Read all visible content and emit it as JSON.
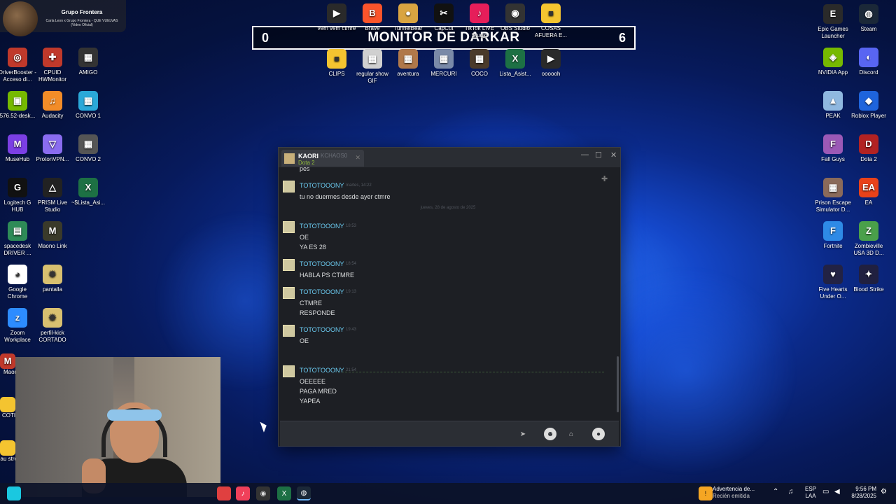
{
  "profile": {
    "name": "Grupo Frontera",
    "song": "Carla Leon x Grupo Frontera - QUE VUELVAS (Video Oficial)"
  },
  "banner": {
    "left_score": "0",
    "title": "MONITOR DE DARKAR",
    "right_score": "6"
  },
  "top_icons": [
    {
      "label": "vem vem ctmre",
      "color": "#2a2a2a",
      "glyph": "▶"
    },
    {
      "label": "Brave",
      "color": "#fb542b",
      "glyph": "B"
    },
    {
      "label": "TunnelBear",
      "color": "#d9a441",
      "glyph": "●"
    },
    {
      "label": "CapCut",
      "color": "#111111",
      "glyph": "✂"
    },
    {
      "label": "TikTok LIVE Studio",
      "color": "#e61e5a",
      "glyph": "♪"
    },
    {
      "label": "OBS Studio",
      "color": "#333333",
      "glyph": "◉"
    },
    {
      "label": "COSAS AFUERA E...",
      "color": "#f4c430",
      "glyph": "■"
    },
    {
      "label": "CLIPS",
      "color": "#f4c430",
      "glyph": "■"
    },
    {
      "label": "regular show GIF",
      "color": "#d0d0d0",
      "glyph": "▦"
    },
    {
      "label": "aventura",
      "color": "#b0784a",
      "glyph": "▦"
    },
    {
      "label": "MERCURI",
      "color": "#7a8aa8",
      "glyph": "▦"
    },
    {
      "label": "COCO",
      "color": "#4a3a2a",
      "glyph": "▦"
    },
    {
      "label": "Lista_Asist...",
      "color": "#1d7044",
      "glyph": "X"
    },
    {
      "label": "oooooh",
      "color": "#2a2a2a",
      "glyph": "▶"
    }
  ],
  "left_icons": [
    {
      "label": "DriverBooster - Acceso di...",
      "color": "#c0392b",
      "glyph": "◎"
    },
    {
      "label": "CPUID HWMonitor",
      "color": "#c0392b",
      "glyph": "✚"
    },
    {
      "label": "AMIGO",
      "color": "#333333",
      "glyph": "▦"
    },
    {
      "label": "576.52-desk...",
      "color": "#76b900",
      "glyph": "▣"
    },
    {
      "label": "Audacity",
      "color": "#f28c28",
      "glyph": "♫"
    },
    {
      "label": "CONVO 1",
      "color": "#2aa8d8",
      "glyph": "▦"
    },
    {
      "label": "MuseHub",
      "color": "#7b3fe4",
      "glyph": "M"
    },
    {
      "label": "ProtonVPN...",
      "color": "#8a6cf0",
      "glyph": "▽"
    },
    {
      "label": "CONVO 2",
      "color": "#555555",
      "glyph": "▦"
    },
    {
      "label": "Logitech G HUB",
      "color": "#111111",
      "glyph": "G"
    },
    {
      "label": "PRISM Live Studio",
      "color": "#222222",
      "glyph": "△"
    },
    {
      "label": "~$Lista_Asi...",
      "color": "#1d7044",
      "glyph": "X"
    },
    {
      "label": "spacedesk DRIVER ...",
      "color": "#2e8b57",
      "glyph": "▤"
    },
    {
      "label": "Maono Link",
      "color": "#3a3a2a",
      "glyph": "M"
    },
    {
      "label": "Google Chrome",
      "color": "#ffffff",
      "glyph": "◕"
    },
    {
      "label": "pantalla",
      "color": "#d8c070",
      "glyph": "✹"
    },
    {
      "label": "Zoom Workplace",
      "color": "#2d8cff",
      "glyph": "z"
    },
    {
      "label": "perfil-kick CORTADO",
      "color": "#d8c070",
      "glyph": "✹"
    }
  ],
  "right_icons": [
    {
      "label": "Epic Games Launcher",
      "color": "#2a2a2a",
      "glyph": "E"
    },
    {
      "label": "Steam",
      "color": "#1b2838",
      "glyph": "◍"
    },
    {
      "label": "NVIDIA App",
      "color": "#76b900",
      "glyph": "◈"
    },
    {
      "label": "Discord",
      "color": "#5865f2",
      "glyph": "◐"
    },
    {
      "label": "PEAK",
      "color": "#8fb8e0",
      "glyph": "▲"
    },
    {
      "label": "Roblox Player",
      "color": "#1e64dc",
      "glyph": "◆"
    },
    {
      "label": "Fall Guys",
      "color": "#9b59b6",
      "glyph": "F"
    },
    {
      "label": "Dota 2",
      "color": "#b22222",
      "glyph": "D"
    },
    {
      "label": "Prison Escape Simulator D...",
      "color": "#8a6a5a",
      "glyph": "▦"
    },
    {
      "label": "EA",
      "color": "#e8421a",
      "glyph": "EA"
    },
    {
      "label": "Fortnite",
      "color": "#2e8ae6",
      "glyph": "F"
    },
    {
      "label": "Zombieville USA 3D D...",
      "color": "#4aa04a",
      "glyph": "Z"
    },
    {
      "label": "Five Hearts Under O...",
      "color": "#222244",
      "glyph": "♥"
    },
    {
      "label": "Blood Strike",
      "color": "#202040",
      "glyph": "✦"
    }
  ],
  "left_partial_labels": [
    "Maon",
    "COTIZ",
    "au strea"
  ],
  "chat": {
    "contact": "KAORI",
    "contact_sub": "KCHAOS0",
    "game": "Dota 2",
    "prev_line": "pes",
    "date_separator": "jueves, 28 de agosto de 2025",
    "messages": [
      {
        "name": "TOTOTOOONY",
        "time": "martes, 14:22",
        "lines": [
          "tu no duermes desde ayer ctmre"
        ]
      },
      {
        "name": "TOTOTOOONY",
        "time": "18:53",
        "lines": [
          "OE",
          "YA ES 28"
        ]
      },
      {
        "name": "TOTOTOOONY",
        "time": "18:54",
        "lines": [
          "HABLA PS CTMRE"
        ]
      },
      {
        "name": "TOTOTOOONY",
        "time": "19:13",
        "lines": [
          "CTMRE",
          "RESPONDE"
        ]
      },
      {
        "name": "TOTOTOOONY",
        "time": "19:43",
        "lines": [
          "OE"
        ]
      },
      {
        "name": "TOTOTOOONY",
        "time": "21:54",
        "lines": [
          "OEEEEE",
          "PAGA MRED",
          "YAPEA"
        ]
      }
    ],
    "input_placeholder": ""
  },
  "tray": {
    "notification_title": "Advertencia de...",
    "notification_sub": "Recién emitida",
    "lang1": "ESP",
    "lang2": "LAA",
    "time": "9:56 PM",
    "date": "8/28/2025"
  }
}
